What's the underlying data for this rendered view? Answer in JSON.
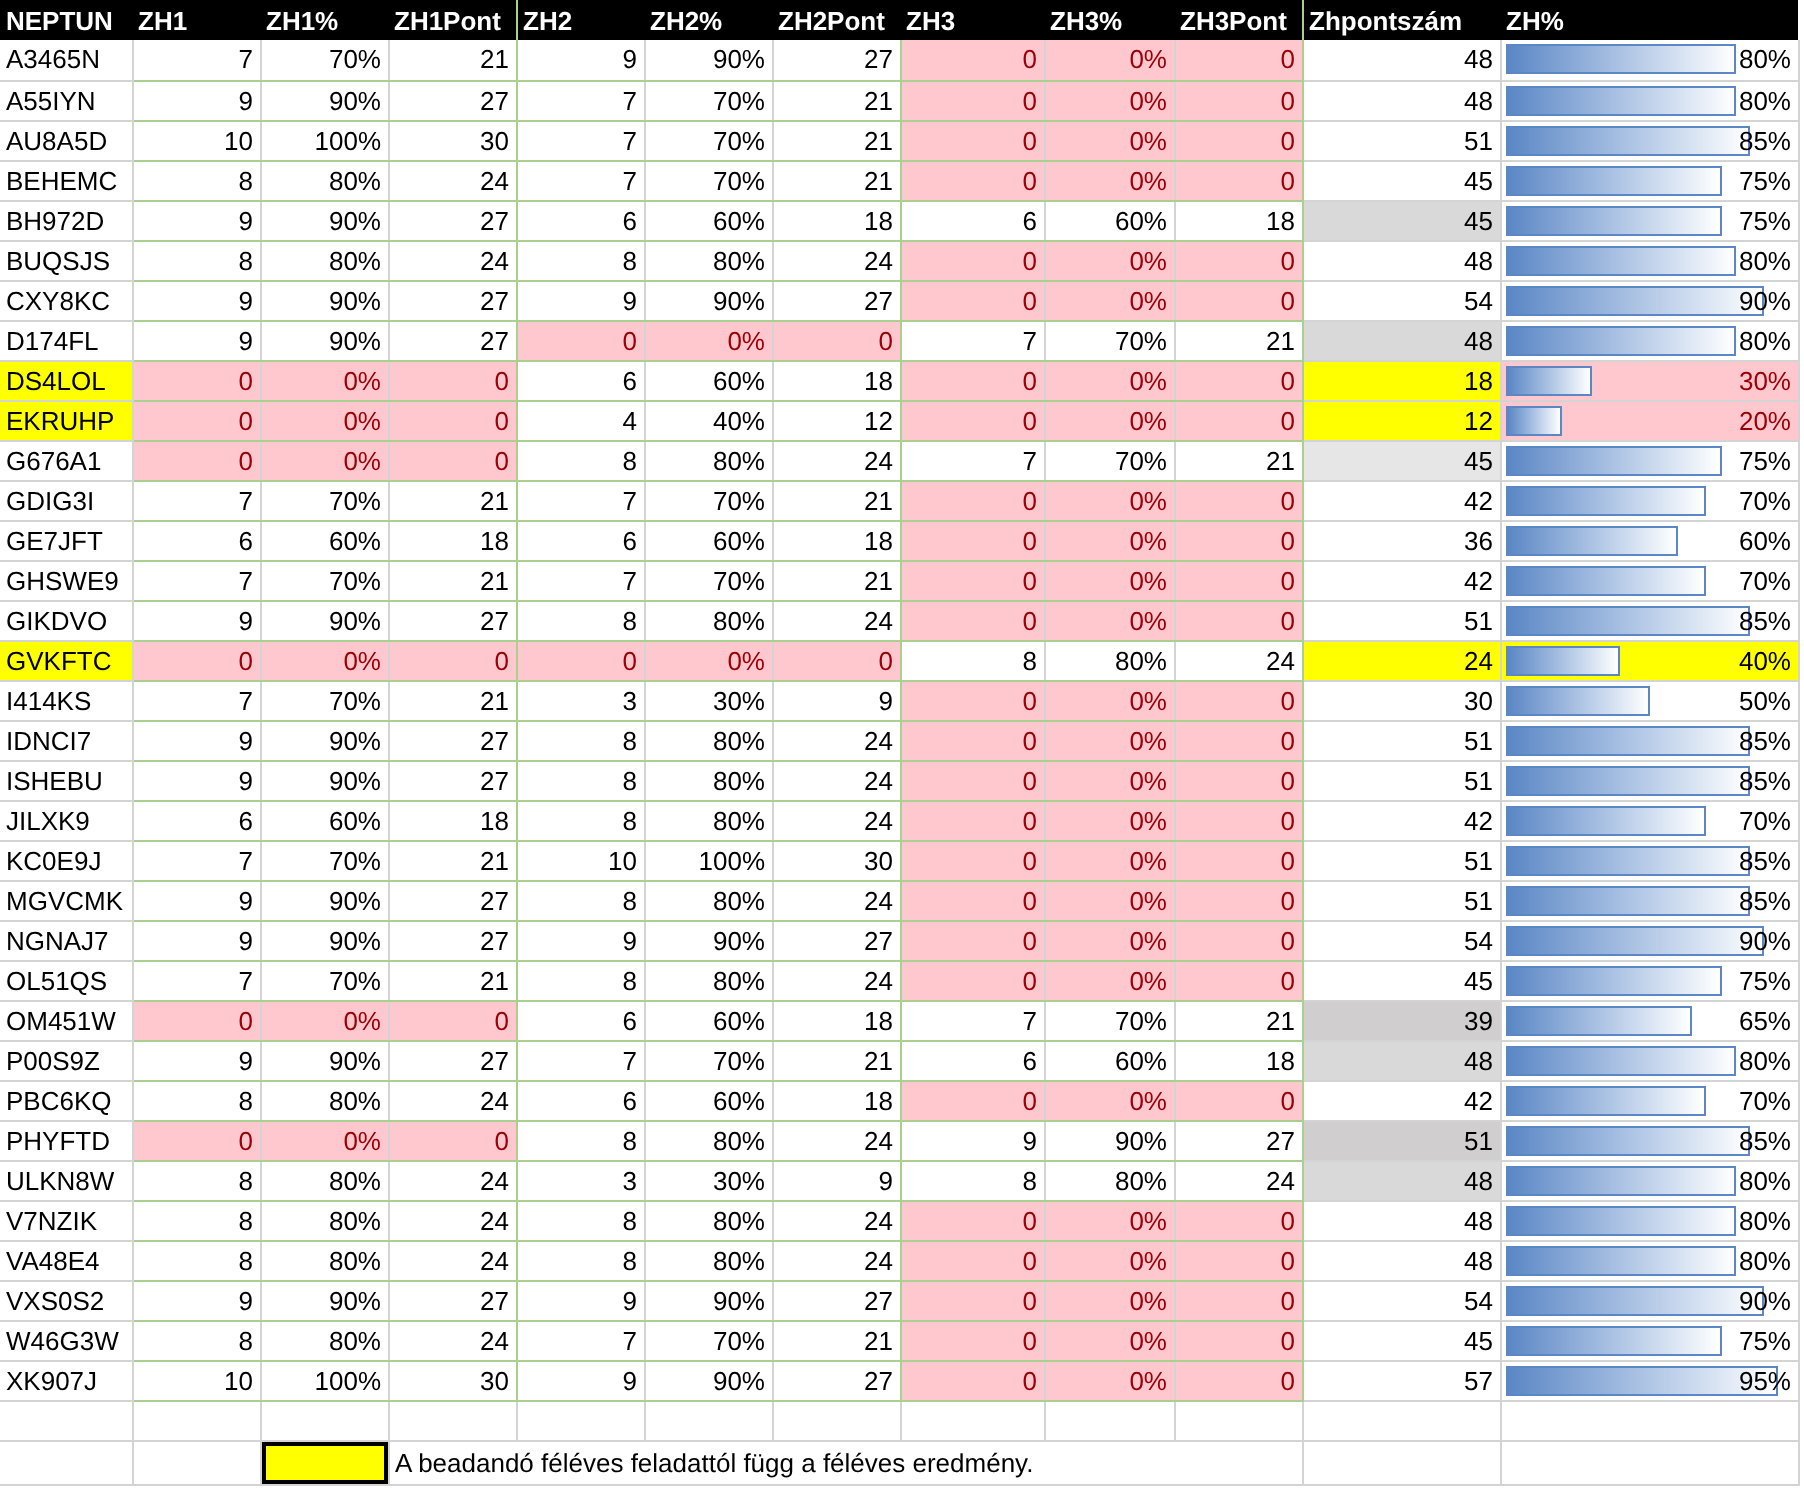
{
  "columns": [
    "NEPTUN",
    "ZH1",
    "ZH1%",
    "ZH1Pont",
    "ZH2",
    "ZH2%",
    "ZH2Pont",
    "ZH3",
    "ZH3%",
    "ZH3Pont",
    "Zhpontszám",
    "ZH%"
  ],
  "rows": [
    {
      "neptun": "A3465N",
      "highlighted": false,
      "zh": [
        {
          "score": "7",
          "percent": "70%",
          "points": "21",
          "failed": false
        },
        {
          "score": "9",
          "percent": "90%",
          "points": "27",
          "failed": false
        },
        {
          "score": "0",
          "percent": "0%",
          "points": "0",
          "failed": true
        }
      ],
      "total": {
        "value": "48",
        "color": "#ffffff"
      },
      "zh_percent": {
        "text": "80%",
        "level": 0.8,
        "failed": false,
        "highlighted": false
      }
    },
    {
      "neptun": "A55IYN",
      "highlighted": false,
      "zh": [
        {
          "score": "9",
          "percent": "90%",
          "points": "27",
          "failed": false
        },
        {
          "score": "7",
          "percent": "70%",
          "points": "21",
          "failed": false
        },
        {
          "score": "0",
          "percent": "0%",
          "points": "0",
          "failed": true
        }
      ],
      "total": {
        "value": "48",
        "color": "#ffffff"
      },
      "zh_percent": {
        "text": "80%",
        "level": 0.8,
        "failed": false,
        "highlighted": false
      }
    },
    {
      "neptun": "AU8A5D",
      "highlighted": false,
      "zh": [
        {
          "score": "10",
          "percent": "100%",
          "points": "30",
          "failed": false
        },
        {
          "score": "7",
          "percent": "70%",
          "points": "21",
          "failed": false
        },
        {
          "score": "0",
          "percent": "0%",
          "points": "0",
          "failed": true
        }
      ],
      "total": {
        "value": "51",
        "color": "#ffffff"
      },
      "zh_percent": {
        "text": "85%",
        "level": 0.85,
        "failed": false,
        "highlighted": false
      }
    },
    {
      "neptun": "BEHEMC",
      "highlighted": false,
      "zh": [
        {
          "score": "8",
          "percent": "80%",
          "points": "24",
          "failed": false
        },
        {
          "score": "7",
          "percent": "70%",
          "points": "21",
          "failed": false
        },
        {
          "score": "0",
          "percent": "0%",
          "points": "0",
          "failed": true
        }
      ],
      "total": {
        "value": "45",
        "color": "#ffffff"
      },
      "zh_percent": {
        "text": "75%",
        "level": 0.75,
        "failed": false,
        "highlighted": false
      }
    },
    {
      "neptun": "BH972D",
      "highlighted": false,
      "zh": [
        {
          "score": "9",
          "percent": "90%",
          "points": "27",
          "failed": false
        },
        {
          "score": "6",
          "percent": "60%",
          "points": "18",
          "failed": false
        },
        {
          "score": "6",
          "percent": "60%",
          "points": "18",
          "failed": false
        }
      ],
      "total": {
        "value": "45",
        "color": "#d9d9d9"
      },
      "zh_percent": {
        "text": "75%",
        "level": 0.75,
        "failed": false,
        "highlighted": false
      }
    },
    {
      "neptun": "BUQSJS",
      "highlighted": false,
      "zh": [
        {
          "score": "8",
          "percent": "80%",
          "points": "24",
          "failed": false
        },
        {
          "score": "8",
          "percent": "80%",
          "points": "24",
          "failed": false
        },
        {
          "score": "0",
          "percent": "0%",
          "points": "0",
          "failed": true
        }
      ],
      "total": {
        "value": "48",
        "color": "#ffffff"
      },
      "zh_percent": {
        "text": "80%",
        "level": 0.8,
        "failed": false,
        "highlighted": false
      }
    },
    {
      "neptun": "CXY8KC",
      "highlighted": false,
      "zh": [
        {
          "score": "9",
          "percent": "90%",
          "points": "27",
          "failed": false
        },
        {
          "score": "9",
          "percent": "90%",
          "points": "27",
          "failed": false
        },
        {
          "score": "0",
          "percent": "0%",
          "points": "0",
          "failed": true
        }
      ],
      "total": {
        "value": "54",
        "color": "#ffffff"
      },
      "zh_percent": {
        "text": "90%",
        "level": 0.9,
        "failed": false,
        "highlighted": false
      }
    },
    {
      "neptun": "D174FL",
      "highlighted": false,
      "zh": [
        {
          "score": "9",
          "percent": "90%",
          "points": "27",
          "failed": false
        },
        {
          "score": "0",
          "percent": "0%",
          "points": "0",
          "failed": true
        },
        {
          "score": "7",
          "percent": "70%",
          "points": "21",
          "failed": false
        }
      ],
      "total": {
        "value": "48",
        "color": "#d9d9d9"
      },
      "zh_percent": {
        "text": "80%",
        "level": 0.8,
        "failed": false,
        "highlighted": false
      }
    },
    {
      "neptun": "DS4LOL",
      "highlighted": true,
      "zh": [
        {
          "score": "0",
          "percent": "0%",
          "points": "0",
          "failed": true
        },
        {
          "score": "6",
          "percent": "60%",
          "points": "18",
          "failed": false
        },
        {
          "score": "0",
          "percent": "0%",
          "points": "0",
          "failed": true
        }
      ],
      "total": {
        "value": "18",
        "color": "#ffff00"
      },
      "zh_percent": {
        "text": "30%",
        "level": 0.3,
        "failed": true,
        "highlighted": false
      }
    },
    {
      "neptun": "EKRUHP",
      "highlighted": true,
      "zh": [
        {
          "score": "0",
          "percent": "0%",
          "points": "0",
          "failed": true
        },
        {
          "score": "4",
          "percent": "40%",
          "points": "12",
          "failed": false
        },
        {
          "score": "0",
          "percent": "0%",
          "points": "0",
          "failed": true
        }
      ],
      "total": {
        "value": "12",
        "color": "#ffff00"
      },
      "zh_percent": {
        "text": "20%",
        "level": 0.2,
        "failed": true,
        "highlighted": false
      }
    },
    {
      "neptun": "G676A1",
      "highlighted": false,
      "zh": [
        {
          "score": "0",
          "percent": "0%",
          "points": "0",
          "failed": true
        },
        {
          "score": "8",
          "percent": "80%",
          "points": "24",
          "failed": false
        },
        {
          "score": "7",
          "percent": "70%",
          "points": "21",
          "failed": false
        }
      ],
      "total": {
        "value": "45",
        "color": "#e7e6e6"
      },
      "zh_percent": {
        "text": "75%",
        "level": 0.75,
        "failed": false,
        "highlighted": false
      }
    },
    {
      "neptun": "GDIG3I",
      "highlighted": false,
      "zh": [
        {
          "score": "7",
          "percent": "70%",
          "points": "21",
          "failed": false
        },
        {
          "score": "7",
          "percent": "70%",
          "points": "21",
          "failed": false
        },
        {
          "score": "0",
          "percent": "0%",
          "points": "0",
          "failed": true
        }
      ],
      "total": {
        "value": "42",
        "color": "#ffffff"
      },
      "zh_percent": {
        "text": "70%",
        "level": 0.7,
        "failed": false,
        "highlighted": false
      }
    },
    {
      "neptun": "GE7JFT",
      "highlighted": false,
      "zh": [
        {
          "score": "6",
          "percent": "60%",
          "points": "18",
          "failed": false
        },
        {
          "score": "6",
          "percent": "60%",
          "points": "18",
          "failed": false
        },
        {
          "score": "0",
          "percent": "0%",
          "points": "0",
          "failed": true
        }
      ],
      "total": {
        "value": "36",
        "color": "#ffffff"
      },
      "zh_percent": {
        "text": "60%",
        "level": 0.6,
        "failed": false,
        "highlighted": false
      }
    },
    {
      "neptun": "GHSWE9",
      "highlighted": false,
      "zh": [
        {
          "score": "7",
          "percent": "70%",
          "points": "21",
          "failed": false
        },
        {
          "score": "7",
          "percent": "70%",
          "points": "21",
          "failed": false
        },
        {
          "score": "0",
          "percent": "0%",
          "points": "0",
          "failed": true
        }
      ],
      "total": {
        "value": "42",
        "color": "#ffffff"
      },
      "zh_percent": {
        "text": "70%",
        "level": 0.7,
        "failed": false,
        "highlighted": false
      }
    },
    {
      "neptun": "GIKDVO",
      "highlighted": false,
      "zh": [
        {
          "score": "9",
          "percent": "90%",
          "points": "27",
          "failed": false
        },
        {
          "score": "8",
          "percent": "80%",
          "points": "24",
          "failed": false
        },
        {
          "score": "0",
          "percent": "0%",
          "points": "0",
          "failed": true
        }
      ],
      "total": {
        "value": "51",
        "color": "#ffffff"
      },
      "zh_percent": {
        "text": "85%",
        "level": 0.85,
        "failed": false,
        "highlighted": false
      }
    },
    {
      "neptun": "GVKFTC",
      "highlighted": true,
      "zh": [
        {
          "score": "0",
          "percent": "0%",
          "points": "0",
          "failed": true
        },
        {
          "score": "0",
          "percent": "0%",
          "points": "0",
          "failed": true
        },
        {
          "score": "8",
          "percent": "80%",
          "points": "24",
          "failed": false
        }
      ],
      "total": {
        "value": "24",
        "color": "#ffff00"
      },
      "zh_percent": {
        "text": "40%",
        "level": 0.4,
        "failed": false,
        "highlighted": true
      }
    },
    {
      "neptun": "I414KS",
      "highlighted": false,
      "zh": [
        {
          "score": "7",
          "percent": "70%",
          "points": "21",
          "failed": false
        },
        {
          "score": "3",
          "percent": "30%",
          "points": "9",
          "failed": false
        },
        {
          "score": "0",
          "percent": "0%",
          "points": "0",
          "failed": true
        }
      ],
      "total": {
        "value": "30",
        "color": "#ffffff"
      },
      "zh_percent": {
        "text": "50%",
        "level": 0.5,
        "failed": false,
        "highlighted": false
      }
    },
    {
      "neptun": "IDNCI7",
      "highlighted": false,
      "zh": [
        {
          "score": "9",
          "percent": "90%",
          "points": "27",
          "failed": false
        },
        {
          "score": "8",
          "percent": "80%",
          "points": "24",
          "failed": false
        },
        {
          "score": "0",
          "percent": "0%",
          "points": "0",
          "failed": true
        }
      ],
      "total": {
        "value": "51",
        "color": "#ffffff"
      },
      "zh_percent": {
        "text": "85%",
        "level": 0.85,
        "failed": false,
        "highlighted": false
      }
    },
    {
      "neptun": "ISHEBU",
      "highlighted": false,
      "zh": [
        {
          "score": "9",
          "percent": "90%",
          "points": "27",
          "failed": false
        },
        {
          "score": "8",
          "percent": "80%",
          "points": "24",
          "failed": false
        },
        {
          "score": "0",
          "percent": "0%",
          "points": "0",
          "failed": true
        }
      ],
      "total": {
        "value": "51",
        "color": "#ffffff"
      },
      "zh_percent": {
        "text": "85%",
        "level": 0.85,
        "failed": false,
        "highlighted": false
      }
    },
    {
      "neptun": "JILXK9",
      "highlighted": false,
      "zh": [
        {
          "score": "6",
          "percent": "60%",
          "points": "18",
          "failed": false
        },
        {
          "score": "8",
          "percent": "80%",
          "points": "24",
          "failed": false
        },
        {
          "score": "0",
          "percent": "0%",
          "points": "0",
          "failed": true
        }
      ],
      "total": {
        "value": "42",
        "color": "#ffffff"
      },
      "zh_percent": {
        "text": "70%",
        "level": 0.7,
        "failed": false,
        "highlighted": false
      }
    },
    {
      "neptun": "KC0E9J",
      "highlighted": false,
      "zh": [
        {
          "score": "7",
          "percent": "70%",
          "points": "21",
          "failed": false
        },
        {
          "score": "10",
          "percent": "100%",
          "points": "30",
          "failed": false
        },
        {
          "score": "0",
          "percent": "0%",
          "points": "0",
          "failed": true
        }
      ],
      "total": {
        "value": "51",
        "color": "#ffffff"
      },
      "zh_percent": {
        "text": "85%",
        "level": 0.85,
        "failed": false,
        "highlighted": false
      }
    },
    {
      "neptun": "MGVCMK",
      "highlighted": false,
      "zh": [
        {
          "score": "9",
          "percent": "90%",
          "points": "27",
          "failed": false
        },
        {
          "score": "8",
          "percent": "80%",
          "points": "24",
          "failed": false
        },
        {
          "score": "0",
          "percent": "0%",
          "points": "0",
          "failed": true
        }
      ],
      "total": {
        "value": "51",
        "color": "#ffffff"
      },
      "zh_percent": {
        "text": "85%",
        "level": 0.85,
        "failed": false,
        "highlighted": false
      }
    },
    {
      "neptun": "NGNAJ7",
      "highlighted": false,
      "zh": [
        {
          "score": "9",
          "percent": "90%",
          "points": "27",
          "failed": false
        },
        {
          "score": "9",
          "percent": "90%",
          "points": "27",
          "failed": false
        },
        {
          "score": "0",
          "percent": "0%",
          "points": "0",
          "failed": true
        }
      ],
      "total": {
        "value": "54",
        "color": "#ffffff"
      },
      "zh_percent": {
        "text": "90%",
        "level": 0.9,
        "failed": false,
        "highlighted": false
      }
    },
    {
      "neptun": "OL51QS",
      "highlighted": false,
      "zh": [
        {
          "score": "7",
          "percent": "70%",
          "points": "21",
          "failed": false
        },
        {
          "score": "8",
          "percent": "80%",
          "points": "24",
          "failed": false
        },
        {
          "score": "0",
          "percent": "0%",
          "points": "0",
          "failed": true
        }
      ],
      "total": {
        "value": "45",
        "color": "#ffffff"
      },
      "zh_percent": {
        "text": "75%",
        "level": 0.75,
        "failed": false,
        "highlighted": false
      }
    },
    {
      "neptun": "OM451W",
      "highlighted": false,
      "zh": [
        {
          "score": "0",
          "percent": "0%",
          "points": "0",
          "failed": true
        },
        {
          "score": "6",
          "percent": "60%",
          "points": "18",
          "failed": false
        },
        {
          "score": "7",
          "percent": "70%",
          "points": "21",
          "failed": false
        }
      ],
      "total": {
        "value": "39",
        "color": "#d0cece"
      },
      "zh_percent": {
        "text": "65%",
        "level": 0.65,
        "failed": false,
        "highlighted": false
      }
    },
    {
      "neptun": "P00S9Z",
      "highlighted": false,
      "zh": [
        {
          "score": "9",
          "percent": "90%",
          "points": "27",
          "failed": false
        },
        {
          "score": "7",
          "percent": "70%",
          "points": "21",
          "failed": false
        },
        {
          "score": "6",
          "percent": "60%",
          "points": "18",
          "failed": false
        }
      ],
      "total": {
        "value": "48",
        "color": "#d9d9d9"
      },
      "zh_percent": {
        "text": "80%",
        "level": 0.8,
        "failed": false,
        "highlighted": false
      }
    },
    {
      "neptun": "PBC6KQ",
      "highlighted": false,
      "zh": [
        {
          "score": "8",
          "percent": "80%",
          "points": "24",
          "failed": false
        },
        {
          "score": "6",
          "percent": "60%",
          "points": "18",
          "failed": false
        },
        {
          "score": "0",
          "percent": "0%",
          "points": "0",
          "failed": true
        }
      ],
      "total": {
        "value": "42",
        "color": "#ffffff"
      },
      "zh_percent": {
        "text": "70%",
        "level": 0.7,
        "failed": false,
        "highlighted": false
      }
    },
    {
      "neptun": "PHYFTD",
      "highlighted": false,
      "zh": [
        {
          "score": "0",
          "percent": "0%",
          "points": "0",
          "failed": true
        },
        {
          "score": "8",
          "percent": "80%",
          "points": "24",
          "failed": false
        },
        {
          "score": "9",
          "percent": "90%",
          "points": "27",
          "failed": false
        }
      ],
      "total": {
        "value": "51",
        "color": "#d0cece"
      },
      "zh_percent": {
        "text": "85%",
        "level": 0.85,
        "failed": false,
        "highlighted": false
      }
    },
    {
      "neptun": "ULKN8W",
      "highlighted": false,
      "zh": [
        {
          "score": "8",
          "percent": "80%",
          "points": "24",
          "failed": false
        },
        {
          "score": "3",
          "percent": "30%",
          "points": "9",
          "failed": false
        },
        {
          "score": "8",
          "percent": "80%",
          "points": "24",
          "failed": false
        }
      ],
      "total": {
        "value": "48",
        "color": "#d9d9d9"
      },
      "zh_percent": {
        "text": "80%",
        "level": 0.8,
        "failed": false,
        "highlighted": false
      }
    },
    {
      "neptun": "V7NZIK",
      "highlighted": false,
      "zh": [
        {
          "score": "8",
          "percent": "80%",
          "points": "24",
          "failed": false
        },
        {
          "score": "8",
          "percent": "80%",
          "points": "24",
          "failed": false
        },
        {
          "score": "0",
          "percent": "0%",
          "points": "0",
          "failed": true
        }
      ],
      "total": {
        "value": "48",
        "color": "#ffffff"
      },
      "zh_percent": {
        "text": "80%",
        "level": 0.8,
        "failed": false,
        "highlighted": false
      }
    },
    {
      "neptun": "VA48E4",
      "highlighted": false,
      "zh": [
        {
          "score": "8",
          "percent": "80%",
          "points": "24",
          "failed": false
        },
        {
          "score": "8",
          "percent": "80%",
          "points": "24",
          "failed": false
        },
        {
          "score": "0",
          "percent": "0%",
          "points": "0",
          "failed": true
        }
      ],
      "total": {
        "value": "48",
        "color": "#ffffff"
      },
      "zh_percent": {
        "text": "80%",
        "level": 0.8,
        "failed": false,
        "highlighted": false
      }
    },
    {
      "neptun": "VXS0S2",
      "highlighted": false,
      "zh": [
        {
          "score": "9",
          "percent": "90%",
          "points": "27",
          "failed": false
        },
        {
          "score": "9",
          "percent": "90%",
          "points": "27",
          "failed": false
        },
        {
          "score": "0",
          "percent": "0%",
          "points": "0",
          "failed": true
        }
      ],
      "total": {
        "value": "54",
        "color": "#ffffff"
      },
      "zh_percent": {
        "text": "90%",
        "level": 0.9,
        "failed": false,
        "highlighted": false
      }
    },
    {
      "neptun": "W46G3W",
      "highlighted": false,
      "zh": [
        {
          "score": "8",
          "percent": "80%",
          "points": "24",
          "failed": false
        },
        {
          "score": "7",
          "percent": "70%",
          "points": "21",
          "failed": false
        },
        {
          "score": "0",
          "percent": "0%",
          "points": "0",
          "failed": true
        }
      ],
      "total": {
        "value": "45",
        "color": "#ffffff"
      },
      "zh_percent": {
        "text": "75%",
        "level": 0.75,
        "failed": false,
        "highlighted": false
      }
    },
    {
      "neptun": "XK907J",
      "highlighted": false,
      "zh": [
        {
          "score": "10",
          "percent": "100%",
          "points": "30",
          "failed": false
        },
        {
          "score": "9",
          "percent": "90%",
          "points": "27",
          "failed": false
        },
        {
          "score": "0",
          "percent": "0%",
          "points": "0",
          "failed": true
        }
      ],
      "total": {
        "value": "57",
        "color": "#ffffff"
      },
      "zh_percent": {
        "text": "95%",
        "level": 0.95,
        "failed": false,
        "highlighted": false
      }
    }
  ],
  "legend": {
    "color": "#ffff00",
    "text": "A beadandó féléves feladattól függ a féléves eredmény."
  }
}
